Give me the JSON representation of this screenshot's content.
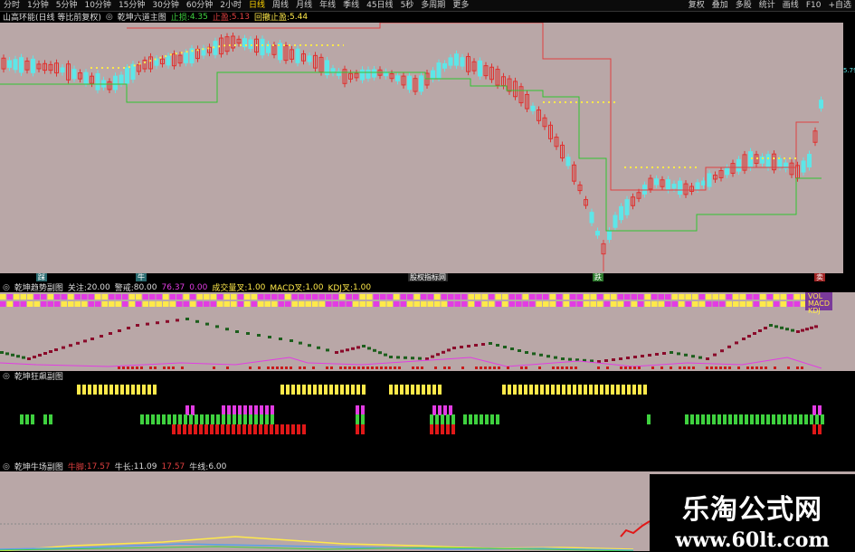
{
  "toolbar": {
    "periods": [
      "分时",
      "1分钟",
      "5分钟",
      "10分钟",
      "15分钟",
      "30分钟",
      "60分钟",
      "2小时",
      "日线",
      "周线",
      "月线",
      "年线",
      "季线",
      "45日线",
      "5秒",
      "多周期",
      "更多"
    ],
    "active_period": "日线",
    "right_items": [
      "复权",
      "叠加",
      "多股",
      "统计",
      "画线",
      "F10",
      "+自选"
    ]
  },
  "main_header": {
    "stock": "山高环能(日线 等比前复权)",
    "indicator": "乾坤六道主图",
    "stop_gain_label": "止损:",
    "stop_gain_value": "4.35",
    "stop_loss_label": "止盈:",
    "stop_loss_value": "5.13",
    "trail_label": "回撤止盈:",
    "trail_value": "5.44"
  },
  "main_price_tag": "5.79",
  "main_bottom_markers": [
    "踩",
    "牛",
    "股权指标网",
    "跌",
    "卖"
  ],
  "pane2_header": {
    "name": "乾坤趋势副图",
    "focus_label": "关注:",
    "focus_value": "20.00",
    "warn_label": "警戒:",
    "warn_value": "80.00",
    "v1": "76.37",
    "v2": "0.00",
    "vol_label": "成交量叉:",
    "vol_value": "1.00",
    "macd_label": "MACD叉:",
    "macd_value": "1.00",
    "kdj_label": "KDJ叉:",
    "kdj_value": "1.00"
  },
  "pane2_right_labels": [
    "VOL",
    "MACD",
    "KDJ"
  ],
  "pane3_header": {
    "name": "乾坤狂飙副图"
  },
  "pane4_header": {
    "name": "乾坤牛场副图",
    "a_label": "牛脚:",
    "a_value": "17.57",
    "b_label": "牛长:",
    "b_value": "11.09",
    "c_value": "17.57",
    "d_label": "牛线:",
    "d_value": "6.00"
  },
  "watermark": {
    "title": "乐淘公式网",
    "url": "www.60lt.com"
  },
  "colors": {
    "pane_bg": "#b9a7a7",
    "bull": "#e0312f",
    "bear": "#5ee6e8",
    "yellow": "#ffe94a",
    "magenta": "#e23ce3",
    "green": "#3fd13f",
    "red_line": "#e04040",
    "green_line": "#31c431"
  }
}
